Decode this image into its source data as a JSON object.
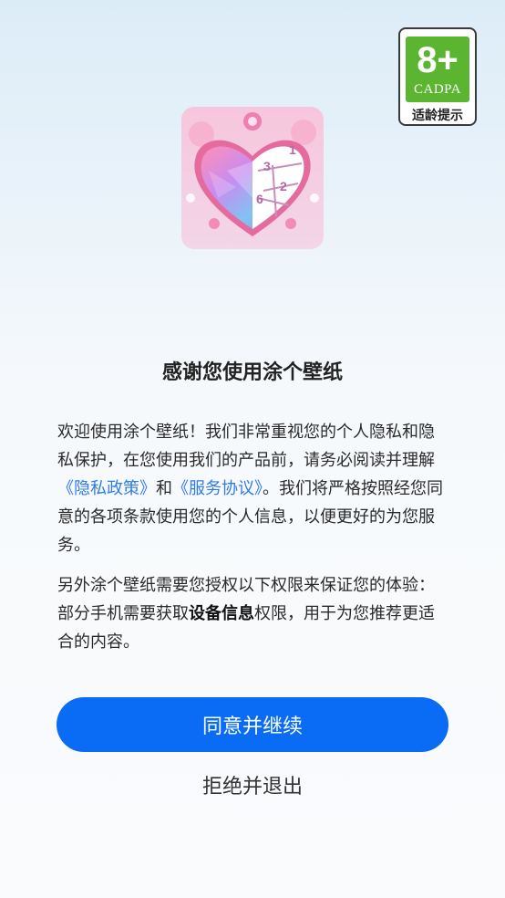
{
  "age_rating": {
    "age": "8+",
    "org": "CADPA",
    "tip": "适龄提示",
    "color": "#5cb531"
  },
  "app_icon": {
    "icon": "heart-paint-by-number-icon",
    "numbers": [
      "1",
      "3",
      "2",
      "6"
    ]
  },
  "dialog": {
    "title": "感谢您使用涂个壁纸",
    "para1": {
      "text1": "欢迎使用涂个壁纸！我们非常重视您的个人隐私和隐私保护，在您使用我们的产品前，请务必阅读并理解",
      "privacy_link": "《隐私政策》",
      "text2": "和",
      "service_link": "《服务协议》",
      "text3": "。我们将严格按照经您同意的各项条款使用您的个人信息，以便更好的为您服务。"
    },
    "para2": {
      "text1": "另外涂个壁纸需要您授权以下权限来保证您的体验：部分手机需要获取",
      "bold": "设备信息",
      "text2": "权限，用于为您推荐更适合的内容。"
    },
    "agree_label": "同意并继续",
    "decline_label": "拒绝并退出",
    "accent_color": "#0a6cf5",
    "link_color": "#2f7be8"
  }
}
